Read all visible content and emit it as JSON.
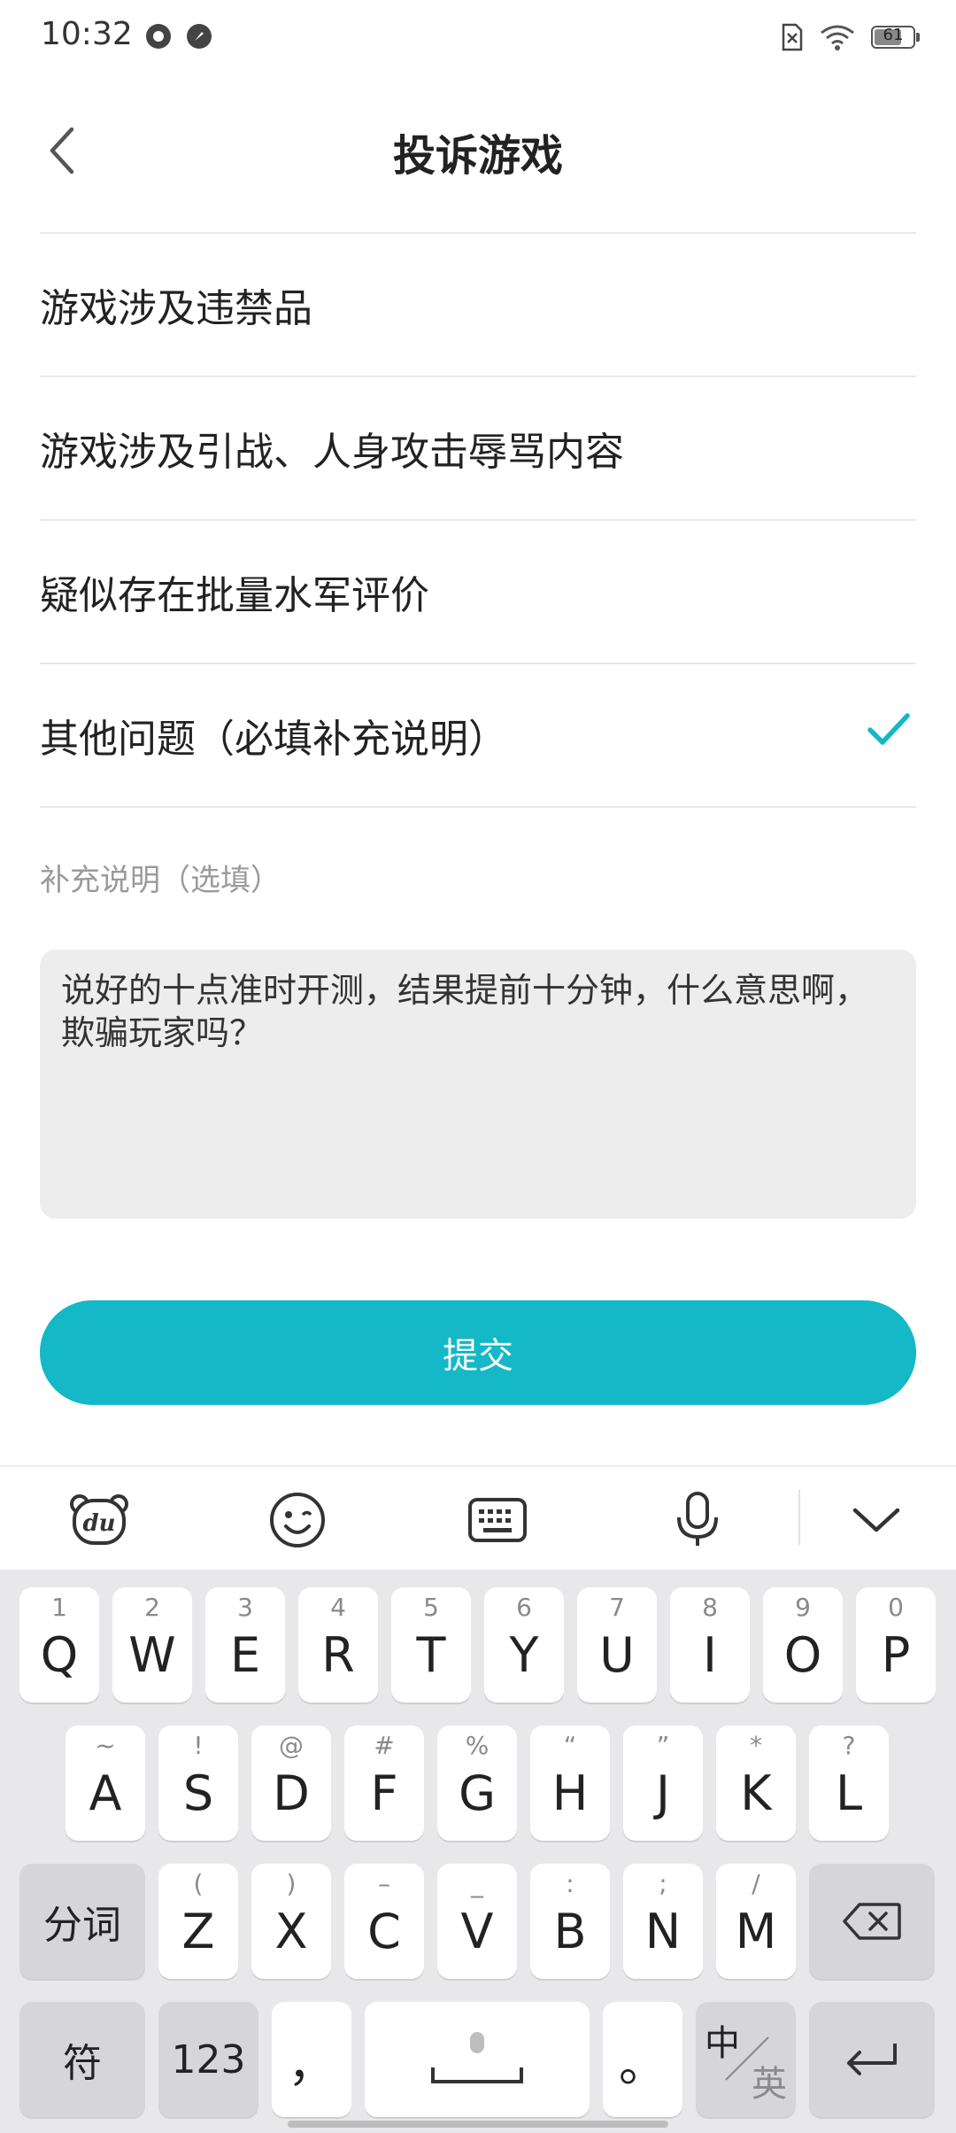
{
  "status_bar": {
    "time": "10:32",
    "battery": "61"
  },
  "header": {
    "title": "投诉游戏"
  },
  "options": [
    {
      "label": "游戏涉及违禁品",
      "selected": false
    },
    {
      "label": "游戏涉及引战、人身攻击辱骂内容",
      "selected": false
    },
    {
      "label": "疑似存在批量水军评价",
      "selected": false
    },
    {
      "label": "其他问题（必填补充说明）",
      "selected": true
    }
  ],
  "supplement": {
    "label": "补充说明（选填）",
    "value": "说好的十点准时开测，结果提前十分钟，什么意思啊，欺骗玩家吗？"
  },
  "submit_label": "提交",
  "colors": {
    "accent": "#14b8c6"
  },
  "keyboard": {
    "toolbar_icons": [
      "du-bear-icon",
      "emoji-icon",
      "keyboard-icon",
      "mic-icon",
      "chevron-down-icon"
    ],
    "row1": [
      {
        "main": "Q",
        "sub": "1"
      },
      {
        "main": "W",
        "sub": "2"
      },
      {
        "main": "E",
        "sub": "3"
      },
      {
        "main": "R",
        "sub": "4"
      },
      {
        "main": "T",
        "sub": "5"
      },
      {
        "main": "Y",
        "sub": "6"
      },
      {
        "main": "U",
        "sub": "7"
      },
      {
        "main": "I",
        "sub": "8"
      },
      {
        "main": "O",
        "sub": "9"
      },
      {
        "main": "P",
        "sub": "0"
      }
    ],
    "row2": [
      {
        "main": "A",
        "sub": "~"
      },
      {
        "main": "S",
        "sub": "!"
      },
      {
        "main": "D",
        "sub": "@"
      },
      {
        "main": "F",
        "sub": "#"
      },
      {
        "main": "G",
        "sub": "%"
      },
      {
        "main": "H",
        "sub": "“"
      },
      {
        "main": "J",
        "sub": "”"
      },
      {
        "main": "K",
        "sub": "*"
      },
      {
        "main": "L",
        "sub": "?"
      }
    ],
    "row3": [
      {
        "main": "Z",
        "sub": "("
      },
      {
        "main": "X",
        "sub": ")"
      },
      {
        "main": "C",
        "sub": "–"
      },
      {
        "main": "V",
        "sub": "_"
      },
      {
        "main": "B",
        "sub": ":"
      },
      {
        "main": "N",
        "sub": ";"
      },
      {
        "main": "M",
        "sub": "/"
      }
    ],
    "segment_label": "分词",
    "symbol_label": "符",
    "number_label": "123",
    "comma": "，",
    "period": "。",
    "lang_zh": "中",
    "lang_en": "英"
  }
}
